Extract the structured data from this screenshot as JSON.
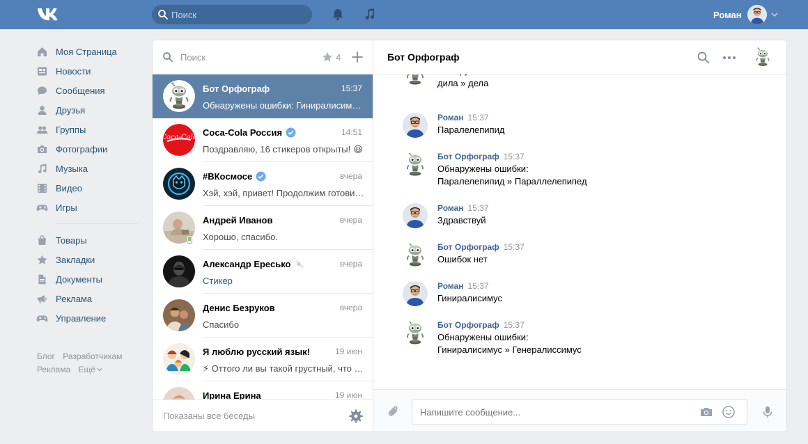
{
  "header": {
    "search_placeholder": "Поиск",
    "user_name": "Роман"
  },
  "nav": {
    "main": [
      {
        "label": "Моя Страница",
        "icon": "home-icon"
      },
      {
        "label": "Новости",
        "icon": "news-icon"
      },
      {
        "label": "Сообщения",
        "icon": "messages-icon"
      },
      {
        "label": "Друзья",
        "icon": "friends-icon"
      },
      {
        "label": "Группы",
        "icon": "groups-icon"
      },
      {
        "label": "Фотографии",
        "icon": "camera-icon"
      },
      {
        "label": "Музыка",
        "icon": "music-icon"
      },
      {
        "label": "Видео",
        "icon": "video-icon"
      },
      {
        "label": "Игры",
        "icon": "gamepad-icon"
      }
    ],
    "secondary": [
      {
        "label": "Товары",
        "icon": "shopping-bag-icon"
      },
      {
        "label": "Закладки",
        "icon": "star-icon"
      },
      {
        "label": "Документы",
        "icon": "document-icon"
      },
      {
        "label": "Реклама",
        "icon": "megaphone-icon"
      },
      {
        "label": "Управление",
        "icon": "gamepad-icon"
      }
    ],
    "footer": [
      "Блог",
      "Разработчикам",
      "Реклама",
      "Ещё"
    ]
  },
  "dialogs": {
    "search_placeholder": "Поиск",
    "important_count": "4",
    "footer_text": "Показаны все беседы",
    "items": [
      {
        "name": "Бот Орфограф",
        "time": "15:37",
        "preview": "Обнаружены ошибки: Гиниралисимус » Генералиссимус",
        "avatar": "robot",
        "active": true
      },
      {
        "name": "Coca-Cola Россия",
        "time": "14:51",
        "preview": "Поздравляю, 16 стикеров открыты!",
        "avatar": "cocacola",
        "verified": true,
        "emoji": "😆"
      },
      {
        "name": "#ВКосмосе",
        "time": "вчера",
        "preview": "Хэй, хэй, привет! Продолжим готовиться",
        "avatar": "space",
        "verified": true
      },
      {
        "name": "Андрей Иванов",
        "time": "вчера",
        "preview": "Хорошо, спасибо.",
        "avatar": "person1",
        "mobile": true
      },
      {
        "name": "Александр Ересько",
        "time": "вчера",
        "preview": "Стикер",
        "avatar": "person2",
        "muted": true,
        "preview_link": true
      },
      {
        "name": "Денис Безруков",
        "time": "вчера",
        "preview": "Спасибо",
        "avatar": "person3"
      },
      {
        "name": "Я люблю русский язык!",
        "time": "19 июн",
        "preview": "⚡ Оттого ли вы такой грустный, что не знаете",
        "avatar": "group"
      },
      {
        "name": "Ирина Ерина",
        "time": "19 июн",
        "preview": "",
        "avatar": "person4"
      }
    ]
  },
  "chat": {
    "title": "Бот Орфограф",
    "composer_placeholder": "Напишите сообщение...",
    "messages": [
      {
        "author": "",
        "time": "",
        "lines": [
          "Обнаружены ошибки:",
          "дила » дела"
        ],
        "avatar": "robot"
      },
      {
        "author": "Роман",
        "time": "15:37",
        "lines": [
          "Паралелепипид"
        ],
        "avatar": "roman"
      },
      {
        "author": "Бот Орфограф",
        "time": "15:37",
        "lines": [
          "Обнаружены ошибки:",
          "Паралелепипид » Параллелепипед"
        ],
        "avatar": "robot"
      },
      {
        "author": "Роман",
        "time": "15:37",
        "lines": [
          "Здравствуй"
        ],
        "avatar": "roman"
      },
      {
        "author": "Бот Орфограф",
        "time": "15:37",
        "lines": [
          "Ошибок нет"
        ],
        "avatar": "robot"
      },
      {
        "author": "Роман",
        "time": "15:37",
        "lines": [
          "Гиниралисимус"
        ],
        "avatar": "roman"
      },
      {
        "author": "Бот Орфограф",
        "time": "15:37",
        "lines": [
          "Обнаружены ошибки:",
          "Гиниралисимус » Генералиссимус"
        ],
        "avatar": "robot"
      }
    ]
  },
  "colors": {
    "header": "#5181b8",
    "active_dialog": "#5e81a8",
    "link": "#2a5885",
    "author": "#42648b",
    "nav_icon": "#99a2ad"
  }
}
